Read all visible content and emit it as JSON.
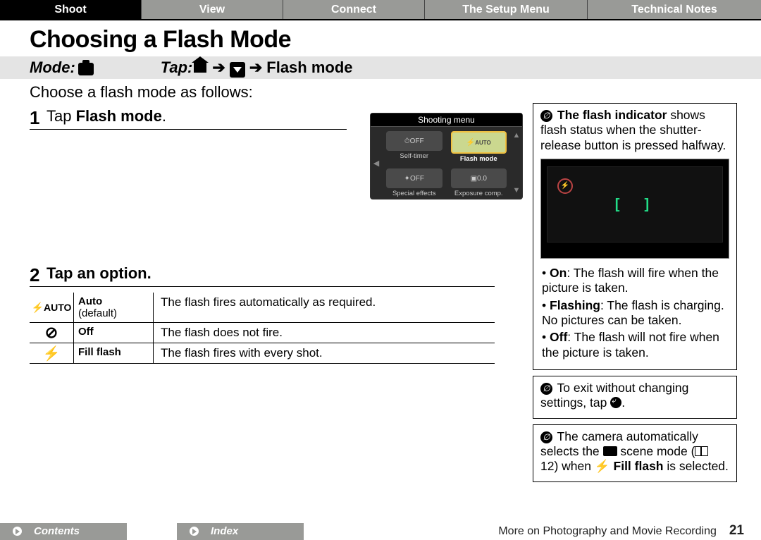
{
  "tabs": {
    "shoot": "Shoot",
    "view": "View",
    "connect": "Connect",
    "setup": "The Setup Menu",
    "tech": "Technical Notes"
  },
  "title": "Choosing a Flash Mode",
  "modebar": {
    "mode": "Mode:",
    "tap": "Tap:",
    "flashmode": "Flash mode"
  },
  "intro": "Choose a flash mode as follows:",
  "step1": {
    "num": "1",
    "pre": "Tap ",
    "bold": "Flash mode",
    "post": "."
  },
  "step2": {
    "num": "2",
    "text": "Tap an option."
  },
  "shootingMenu": {
    "title": "Shooting menu",
    "selfTimer": {
      "icon": "OFF",
      "label": "Self-timer"
    },
    "flashMode": {
      "icon": "AUTO",
      "label": "Flash mode"
    },
    "specialEffects": {
      "icon": "OFF",
      "label": "Special effects"
    },
    "exposure": {
      "icon": "0.0",
      "label": "Exposure comp."
    }
  },
  "options": [
    {
      "icon": "⚡AUTO",
      "name": "Auto",
      "sub": "(default)",
      "desc": "The flash fires automatically as required."
    },
    {
      "icon": "⊘",
      "name": "Off",
      "sub": "",
      "desc": "The flash does not fire."
    },
    {
      "icon": "⚡",
      "name": "Fill flash",
      "sub": "",
      "desc": "The flash fires with every shot."
    }
  ],
  "sidebar": {
    "indicator_bold": "The flash indicator",
    "indicator_rest": " shows flash status when the shutter-release button is pressed halfway.",
    "on_b": "On",
    "on": "The flash will fire when the picture is taken.",
    "fl_b": "Flashing",
    "fl": "The flash is charging. No pictures can be taken.",
    "off_b": "Off",
    "off": "The flash will not fire when the picture is taken.",
    "exit": "To exit without changing settings, tap ",
    "auto_sel_1": "The camera automatically selects the ",
    "auto_sel_2": " scene mode (",
    "auto_sel_3": " 12) when ",
    "fillflash": "Fill flash",
    "auto_sel_4": " is selected."
  },
  "footer": {
    "contents": "Contents",
    "index": "Index",
    "section": "More on Photography and Movie Recording",
    "page": "21"
  }
}
